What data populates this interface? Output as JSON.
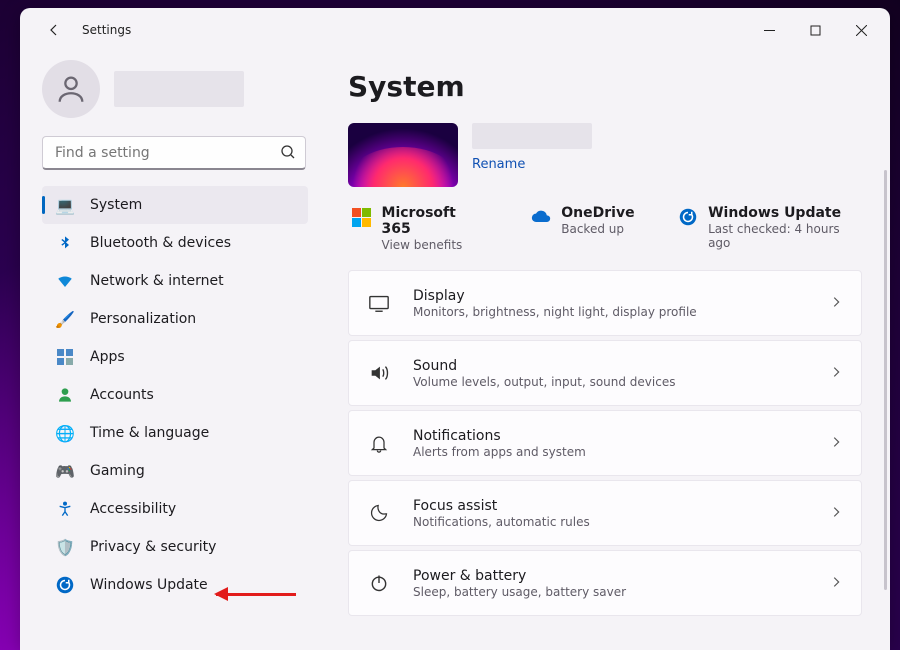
{
  "window": {
    "title": "Settings"
  },
  "search": {
    "placeholder": "Find a setting"
  },
  "sidebar": {
    "items": [
      {
        "icon": "💻",
        "label": "System",
        "active": true,
        "key": "system"
      },
      {
        "icon": "bt",
        "label": "Bluetooth & devices",
        "key": "bluetooth"
      },
      {
        "icon": "wifi",
        "label": "Network & internet",
        "key": "network"
      },
      {
        "icon": "🖌️",
        "label": "Personalization",
        "key": "personalization"
      },
      {
        "icon": "apps",
        "label": "Apps",
        "key": "apps"
      },
      {
        "icon": "acct",
        "label": "Accounts",
        "key": "accounts"
      },
      {
        "icon": "🌐",
        "label": "Time & language",
        "key": "time"
      },
      {
        "icon": "🎮",
        "label": "Gaming",
        "key": "gaming"
      },
      {
        "icon": "a11y",
        "label": "Accessibility",
        "key": "accessibility"
      },
      {
        "icon": "🛡️",
        "label": "Privacy & security",
        "key": "privacy"
      },
      {
        "icon": "update",
        "label": "Windows Update",
        "key": "update"
      }
    ]
  },
  "main": {
    "heading": "System",
    "rename": "Rename",
    "status": [
      {
        "title": "Microsoft 365",
        "sub": "View benefits",
        "icon": "ms"
      },
      {
        "title": "OneDrive",
        "sub": "Backed up",
        "icon": "cloud"
      },
      {
        "title": "Windows Update",
        "sub": "Last checked: 4 hours ago",
        "icon": "update"
      }
    ],
    "cards": [
      {
        "title": "Display",
        "sub": "Monitors, brightness, night light, display profile",
        "icon": "display",
        "key": "display"
      },
      {
        "title": "Sound",
        "sub": "Volume levels, output, input, sound devices",
        "icon": "sound",
        "key": "sound"
      },
      {
        "title": "Notifications",
        "sub": "Alerts from apps and system",
        "icon": "bell",
        "key": "notifications"
      },
      {
        "title": "Focus assist",
        "sub": "Notifications, automatic rules",
        "icon": "moon",
        "key": "focus"
      },
      {
        "title": "Power & battery",
        "sub": "Sleep, battery usage, battery saver",
        "icon": "power",
        "key": "power"
      }
    ]
  },
  "colors": {
    "accent": "#0067c0",
    "annotation": "#e21b1b"
  }
}
